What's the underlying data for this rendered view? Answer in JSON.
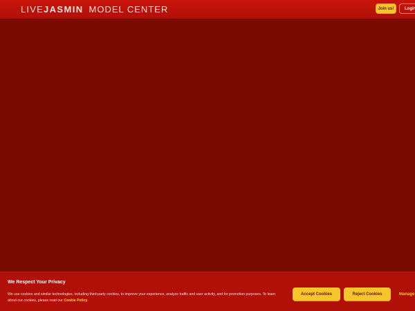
{
  "header": {
    "logo_part1": "LIVE",
    "logo_part2": "JASMIN",
    "logo_part3": "MODEL CENTER",
    "join_label": "Join us!",
    "login_label": "Login"
  },
  "cookie_banner": {
    "title": "We Respect Your Privacy",
    "text": "We use cookies and similar technologies, including third-party cookies, to improve your experience, analyze traffic and user activity, and for promotion purposes. To learn about our cookies, please read our",
    "policy_link": "Cookie Policy",
    "text_end": ".",
    "accept_label": "Accept Cookies",
    "reject_label": "Reject Cookies",
    "manage_label": "Manage Cookies"
  },
  "colors": {
    "background": "#7a0b00",
    "header": "#c9150b",
    "banner": "#b01008",
    "accent": "#f6c52b"
  }
}
